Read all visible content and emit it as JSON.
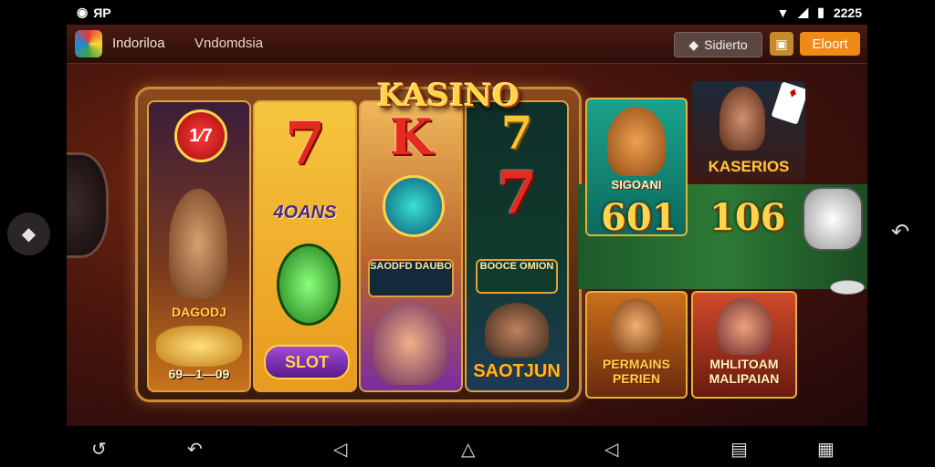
{
  "status_bar": {
    "left_text": "ЯР",
    "time": "2225"
  },
  "top_bar": {
    "title": "Indoriloa",
    "tab": "Vndomdsia",
    "sidebets_label": "Sidierto",
    "elect_label": "Eloort"
  },
  "game": {
    "logo_text": "KASINO",
    "reel1": {
      "heart_text": "1⁄7",
      "panel_text": "DAGODJ",
      "score": "69—1—09"
    },
    "reel2": {
      "symbol1": "7",
      "label": "4OANS",
      "slot_button": "SLOT"
    },
    "reel3": {
      "symbol1": "K",
      "plate_text": "SAODFD DAUBO"
    },
    "reel4": {
      "symbol1": "7",
      "symbol2": "7",
      "plate_text": "BOOCE OMION",
      "label": "SAOTJUN"
    },
    "right_panel": {
      "card1_label": "SIGOANI",
      "card2_label": "KASERIOS",
      "score_left": "601",
      "score_right": "106",
      "card3_label": "PERMAINS PERIEN",
      "card4_label": "MHLITOAM MALIPAIAN"
    }
  },
  "colors": {
    "accent": "#f08a16",
    "gold": "#ffd34a",
    "felt": "#2d7a36"
  }
}
